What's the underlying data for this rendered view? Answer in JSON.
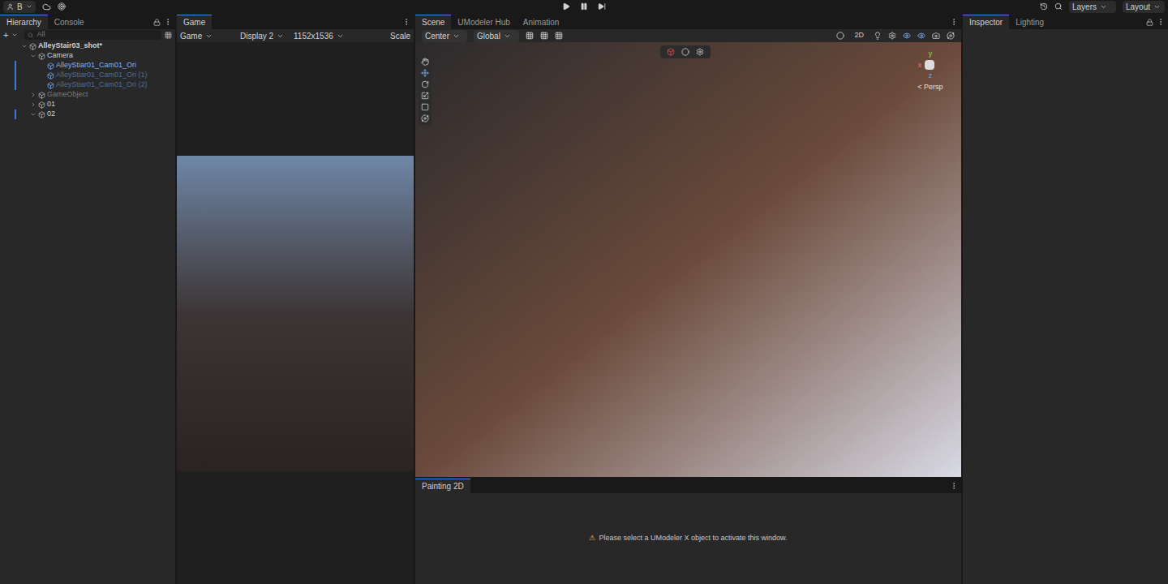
{
  "toolbar": {
    "account": "B",
    "layers": "Layers",
    "layout": "Layout"
  },
  "hierarchy": {
    "tabs": [
      {
        "label": "Hierarchy",
        "selected": true
      },
      {
        "label": "Console",
        "selected": false
      }
    ],
    "add": "+",
    "search": {
      "placeholder": "All"
    },
    "items": [
      {
        "label": "AlleyStair03_shot*",
        "depth": 0,
        "kind": "scene",
        "expanded": true,
        "active": true,
        "prefab": false,
        "modified": false
      },
      {
        "label": "Camera",
        "depth": 1,
        "kind": "object",
        "expanded": true,
        "active": true,
        "prefab": false,
        "modified": false
      },
      {
        "label": "AlleyStiar01_Cam01_Ori",
        "depth": 2,
        "kind": "leaf",
        "expanded": false,
        "active": true,
        "prefab": true,
        "modified": true
      },
      {
        "label": "AlleyStiar01_Cam01_Ori (1)",
        "depth": 2,
        "kind": "leaf",
        "expanded": false,
        "active": false,
        "prefab": true,
        "modified": true
      },
      {
        "label": "AlleyStiar01_Cam01_Ori (2)",
        "depth": 2,
        "kind": "leaf",
        "expanded": false,
        "active": false,
        "prefab": true,
        "modified": true
      },
      {
        "label": "GameObject",
        "depth": 1,
        "kind": "object",
        "expanded": false,
        "active": false,
        "prefab": false,
        "modified": false
      },
      {
        "label": "01",
        "depth": 1,
        "kind": "object",
        "expanded": false,
        "active": true,
        "prefab": false,
        "modified": false
      },
      {
        "label": "02",
        "depth": 1,
        "kind": "object",
        "expanded": true,
        "active": true,
        "prefab": false,
        "modified": true
      }
    ]
  },
  "game": {
    "tabs": [
      {
        "label": "Game",
        "selected": true
      }
    ],
    "toolbar": {
      "view": "Game",
      "display": "Display 2",
      "resolution": "1152x1536",
      "scale": "Scale"
    }
  },
  "scene": {
    "tabs": [
      {
        "label": "Scene",
        "selected": true
      },
      {
        "label": "UModeler Hub",
        "selected": false
      },
      {
        "label": "Animation",
        "selected": false
      }
    ],
    "toolbar": {
      "pivot": "Center",
      "space": "Global",
      "mode_2d": "2D"
    },
    "gizmo": {
      "x": "x",
      "y": "y",
      "z": "z",
      "projection": "< Persp"
    }
  },
  "painting": {
    "tabs": [
      {
        "label": "Painting 2D",
        "selected": true
      }
    ],
    "warning": "⚠",
    "message": "Please select a UModeler X object to activate this window."
  },
  "inspector": {
    "tabs": [
      {
        "label": "Inspector",
        "selected": true
      },
      {
        "label": "Lighting",
        "selected": false
      }
    ]
  }
}
